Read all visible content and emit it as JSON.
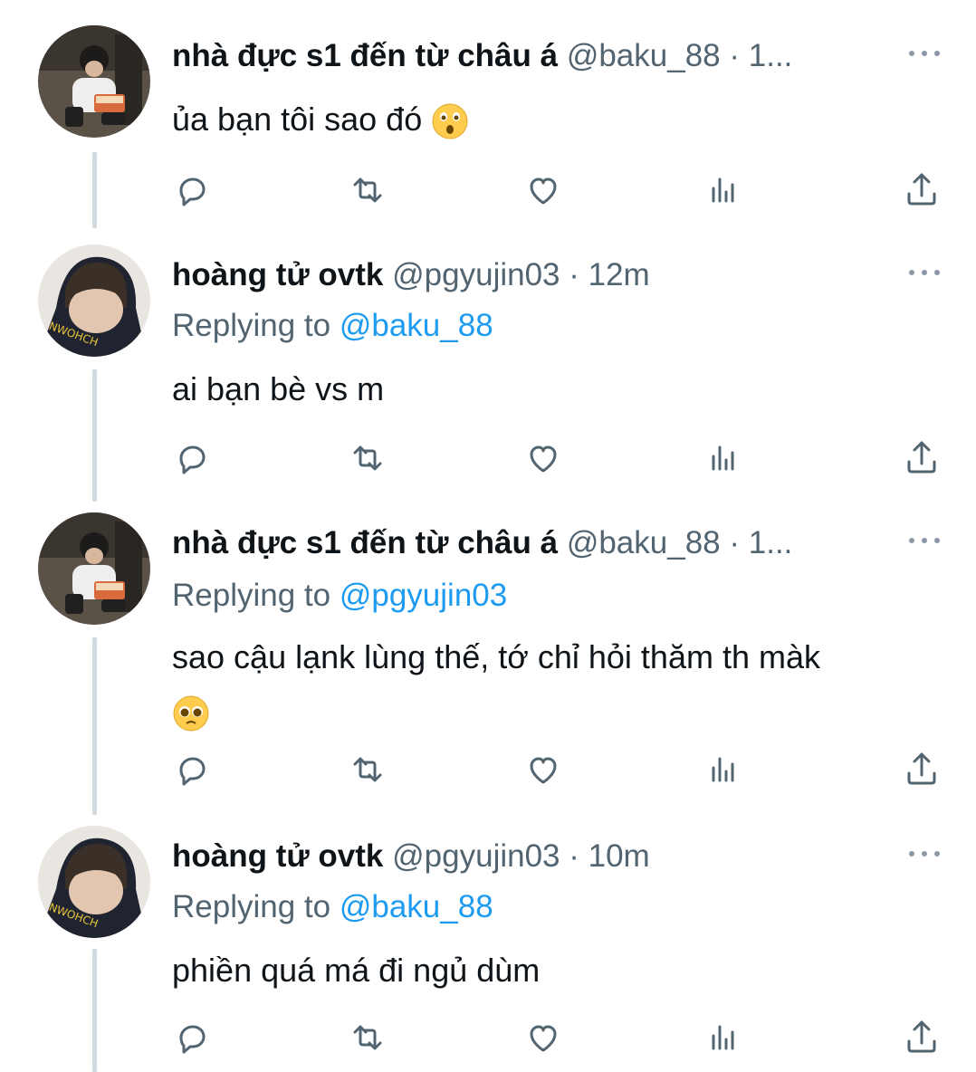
{
  "tweets": [
    {
      "name": "nhà đực s1 đến từ châu á",
      "handle": "@baku_88",
      "time": "· 1...",
      "replying_label": "",
      "replying_to": "",
      "text": "ủa bạn tôi sao đó",
      "emoji": "astonished-face"
    },
    {
      "name": "hoàng tử ovtk",
      "handle": "@pgyujin03",
      "time": "· 12m",
      "replying_label": "Replying to",
      "replying_to": "@baku_88",
      "text": "ai bạn bè vs m",
      "emoji": ""
    },
    {
      "name": "nhà đực s1 đến từ châu á",
      "handle": "@baku_88",
      "time": "· 1...",
      "replying_label": "Replying to",
      "replying_to": "@pgyujin03",
      "text": "sao cậu lạnk lùng thế, tớ chỉ hỏi thăm th màk",
      "emoji": "pleading-face"
    },
    {
      "name": "hoàng tử ovtk",
      "handle": "@pgyujin03",
      "time": "· 10m",
      "replying_label": "Replying to",
      "replying_to": "@baku_88",
      "text": "phiền quá má đi ngủ dùm",
      "emoji": ""
    }
  ],
  "icons": [
    "reply-icon",
    "retweet-icon",
    "like-icon",
    "analytics-icon",
    "share-icon",
    "more-icon"
  ],
  "colors": {
    "text": "#0f1419",
    "secondary": "#536471",
    "link": "#1d9bf0",
    "thread_line": "#cfd9de"
  }
}
